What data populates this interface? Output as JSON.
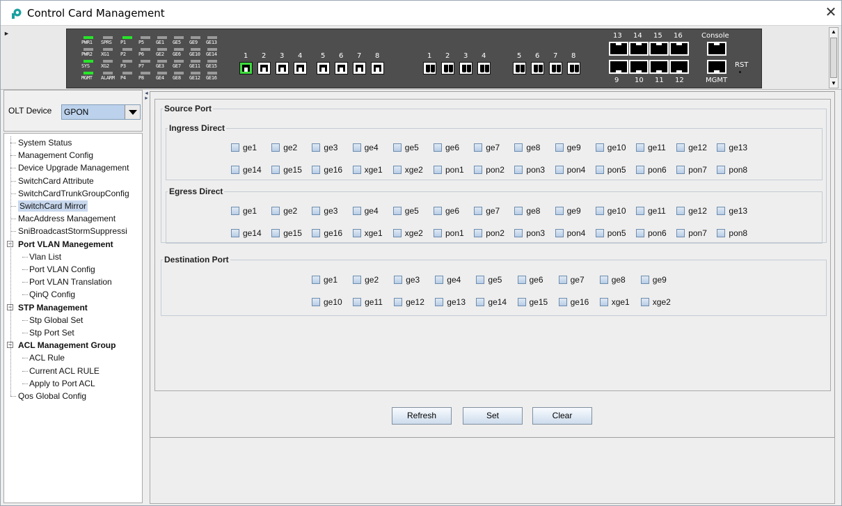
{
  "window": {
    "title": "Control Card Management",
    "close_glyph": "✕"
  },
  "panel": {
    "led_labels": [
      [
        "PWR1",
        "SPRS",
        "P1",
        "P5"
      ],
      [
        "PWR2",
        "XG1",
        "P2",
        "P6"
      ],
      [
        "SYS",
        "XG2",
        "P3",
        "P7"
      ],
      [
        "MGMT",
        "ALARM",
        "P4",
        "P8"
      ]
    ],
    "ge_labels": [
      [
        "GE1",
        "GE5",
        "GE9",
        "GE13"
      ],
      [
        "GE2",
        "GE6",
        "GE10",
        "GE14"
      ],
      [
        "GE3",
        "GE7",
        "GE11",
        "GE15"
      ],
      [
        "GE4",
        "GE8",
        "GE12",
        "GE16"
      ]
    ],
    "rj_numbers": [
      "1",
      "2",
      "3",
      "4",
      "5",
      "6",
      "7",
      "8"
    ],
    "sfp_numbers": [
      "1",
      "2",
      "3",
      "4",
      "5",
      "6",
      "7",
      "8"
    ],
    "big_top_numbers": [
      "13",
      "14",
      "15",
      "16"
    ],
    "big_bottom_numbers": [
      "9",
      "10",
      "11",
      "12"
    ],
    "console_label": "Console",
    "mgmt_label": "MGMT",
    "rst_label": "RST",
    "colors": {
      "panel_bg": "#4e4e4e",
      "led_on": "#27e52a",
      "led_off": "#9a9a9a"
    }
  },
  "sidebar": {
    "olt_label": "OLT Device",
    "olt_value": "GPON",
    "items": [
      "System Status",
      "Management Config",
      "Device Upgrade Management",
      "SwitchCard Attribute",
      "SwitchCardTrunkGroupConfig",
      "SwitchCard Mirror",
      "MacAddress Management",
      "SniBroadcastStormSuppressi",
      "Port VLAN Manegement",
      "Vlan List",
      "Port VLAN Config",
      "Port VLAN Translation",
      "QinQ Config",
      "STP Management",
      "Stp Global Set",
      "Stp Port Set",
      "ACL Management Group",
      "ACL Rule",
      "Current ACL RULE",
      "Apply to Port ACL",
      "Qos Global Config"
    ],
    "selected": "SwitchCard Mirror",
    "collapse_glyph": "−"
  },
  "source": {
    "legend": "Source Port",
    "ingress": {
      "legend": "Ingress Direct",
      "row1": [
        "ge1",
        "ge2",
        "ge3",
        "ge4",
        "ge5",
        "ge6",
        "ge7",
        "ge8",
        "ge9",
        "ge10",
        "ge11",
        "ge12",
        "ge13"
      ],
      "row2": [
        "ge14",
        "ge15",
        "ge16",
        "xge1",
        "xge2",
        "pon1",
        "pon2",
        "pon3",
        "pon4",
        "pon5",
        "pon6",
        "pon7",
        "pon8"
      ]
    },
    "egress": {
      "legend": "Egress Direct",
      "row1": [
        "ge1",
        "ge2",
        "ge3",
        "ge4",
        "ge5",
        "ge6",
        "ge7",
        "ge8",
        "ge9",
        "ge10",
        "ge11",
        "ge12",
        "ge13"
      ],
      "row2": [
        "ge14",
        "ge15",
        "ge16",
        "xge1",
        "xge2",
        "pon1",
        "pon2",
        "pon3",
        "pon4",
        "pon5",
        "pon6",
        "pon7",
        "pon8"
      ]
    }
  },
  "destination": {
    "legend": "Destination Port",
    "row1": [
      "ge1",
      "ge2",
      "ge3",
      "ge4",
      "ge5",
      "ge6",
      "ge7",
      "ge8",
      "ge9"
    ],
    "row2": [
      "ge10",
      "ge11",
      "ge12",
      "ge13",
      "ge14",
      "ge15",
      "ge16",
      "xge1",
      "xge2"
    ]
  },
  "buttons": {
    "refresh": "Refresh",
    "set": "Set",
    "clear": "Clear"
  }
}
